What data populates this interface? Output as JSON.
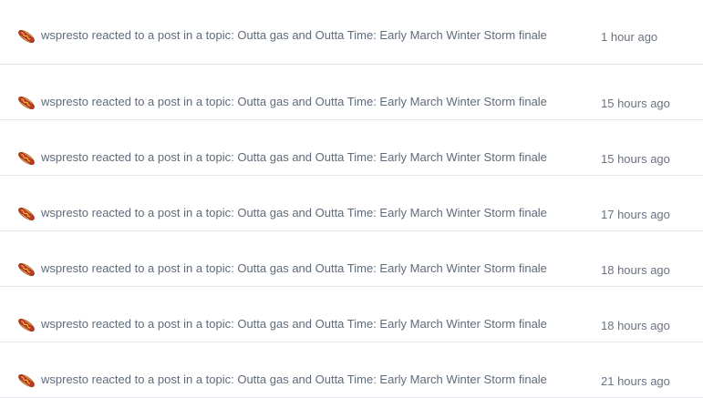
{
  "notifications": [
    {
      "text": "wspresto reacted to a post in a topic: Outta gas and Outta Time: Early March Winter Storm finale",
      "time": "1 hour ago",
      "icon": "hotdog-icon"
    },
    {
      "text": "wspresto reacted to a post in a topic: Outta gas and Outta Time: Early March Winter Storm finale",
      "time": "15 hours ago",
      "icon": "hotdog-icon"
    },
    {
      "text": "wspresto reacted to a post in a topic: Outta gas and Outta Time: Early March Winter Storm finale",
      "time": "15 hours ago",
      "icon": "hotdog-icon"
    },
    {
      "text": "wspresto reacted to a post in a topic: Outta gas and Outta Time: Early March Winter Storm finale",
      "time": "17 hours ago",
      "icon": "hotdog-icon"
    },
    {
      "text": "wspresto reacted to a post in a topic: Outta gas and Outta Time: Early March Winter Storm finale",
      "time": "18 hours ago",
      "icon": "hotdog-icon"
    },
    {
      "text": "wspresto reacted to a post in a topic: Outta gas and Outta Time: Early March Winter Storm finale",
      "time": "18 hours ago",
      "icon": "hotdog-icon"
    },
    {
      "text": "wspresto reacted to a post in a topic: Outta gas and Outta Time: Early March Winter Storm finale",
      "time": "21 hours ago",
      "icon": "hotdog-icon"
    }
  ]
}
